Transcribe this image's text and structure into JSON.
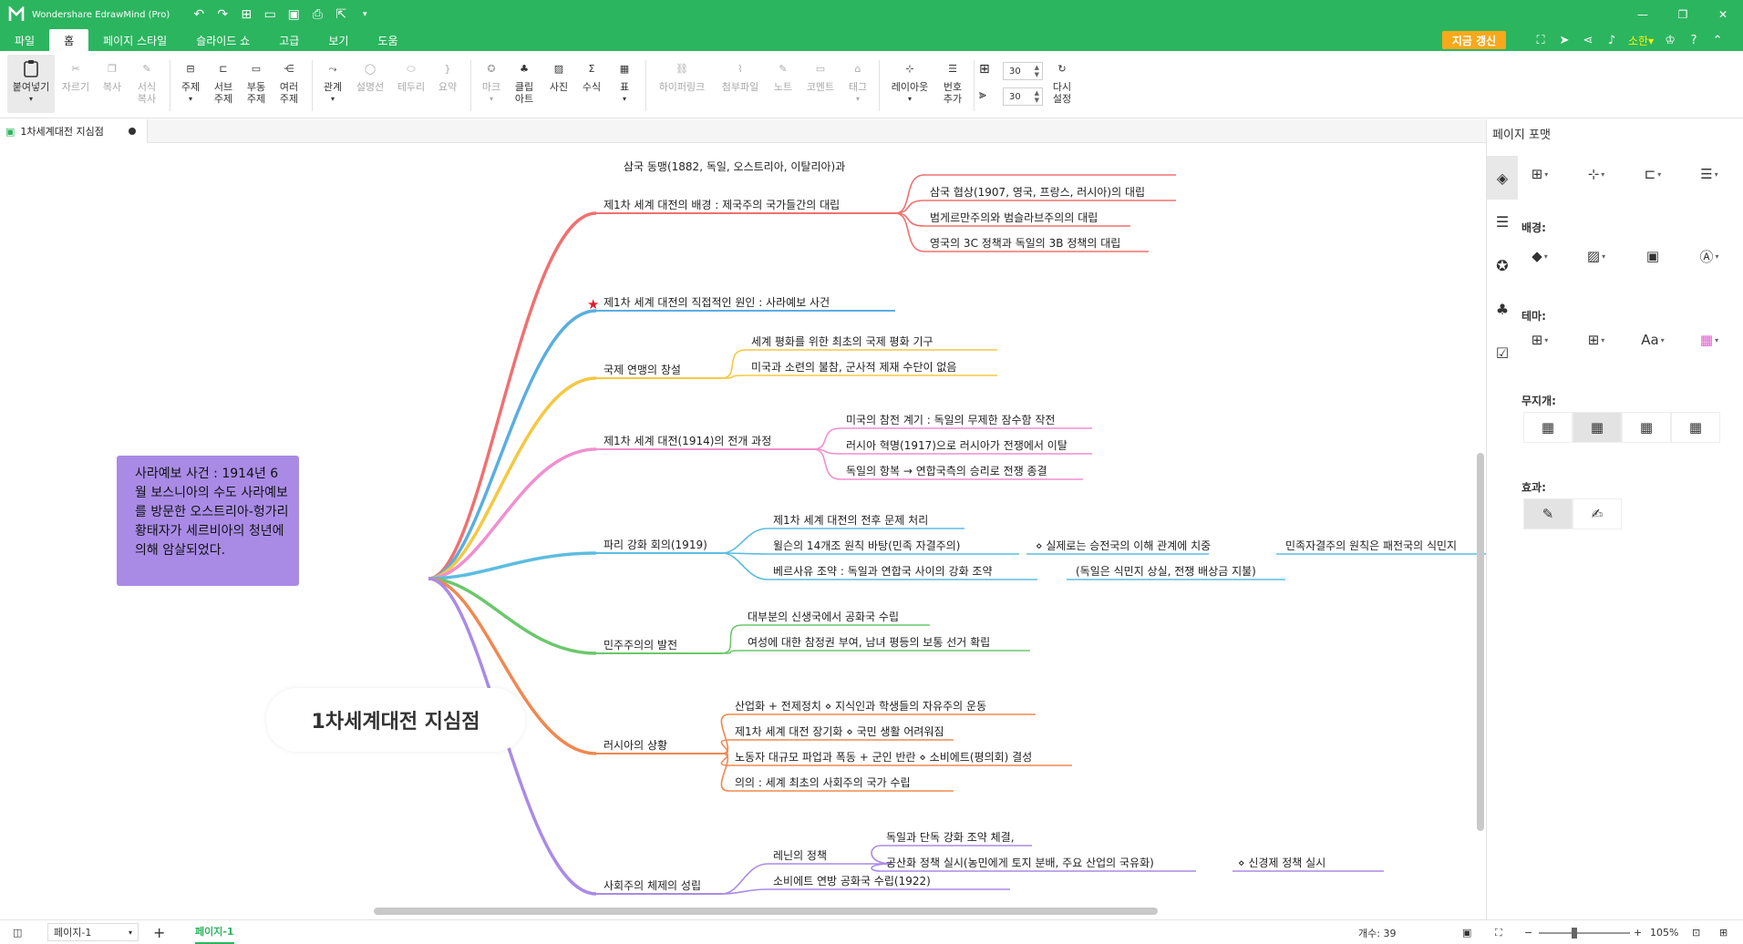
{
  "app": {
    "title": "Wondershare EdrawMind (Pro)"
  },
  "menu": {
    "tabs": [
      "파일",
      "홈",
      "페이지 스타일",
      "슬라이드 쇼",
      "고급",
      "보기",
      "도움"
    ],
    "active": 1
  },
  "header_right": {
    "upgrade": "지금 갱신",
    "user": "소한▾"
  },
  "ribbon": {
    "paste": "붙여넣기",
    "cut": "자르기",
    "copy": "복사",
    "format_copy": "서식\n복사",
    "topic": "주제",
    "subtopic": "서브\n주제",
    "floating": "부동\n주제",
    "multiple": "여러\n주제",
    "relation": "관계",
    "callout": "설명선",
    "boundary": "테두리",
    "summary": "요약",
    "mark": "마크",
    "clipart": "클립\n아트",
    "picture": "사진",
    "formula": "수식",
    "table": "표",
    "hyperlink": "하이퍼링크",
    "attachment": "첨부파일",
    "note": "노트",
    "comment": "코멘트",
    "tag": "태그",
    "layout": "레이아웃",
    "numbering": "번호\n추가",
    "spacing_h": "30",
    "spacing_v": "30",
    "reset": "다시\n설정"
  },
  "document": {
    "tab": "1차세계대전 지심점"
  },
  "mindmap": {
    "central": "1차세계대전 지심점",
    "callout": "사라예보 사건 : 1914년 6월 보스니아의 수도 사라예보를 방문한 오스트리아-헝가리 황태자가 세르비아의 청년에 의해 암살되었다.",
    "branches": [
      {
        "label": "제1차 세계 대전의 배경 : 제국주의 국가들간의 대립",
        "color": "#f07070",
        "children": [
          "삼국 동맹(1882, 독일, 오스트리아, 이탈리아)과",
          "삼국 협상(1907, 영국, 프랑스, 러시아)의 대립",
          "범게르만주의와 범슬라브주의의 대립",
          "영국의 3C 정책과 독일의 3B 정책의 대립"
        ]
      },
      {
        "label": "제1차 세계 대전의 직접적인 원인 : 사라예보 사건",
        "color": "#5aaee0",
        "children": []
      },
      {
        "label": "국제 연맹의 창설",
        "color": "#f5c842",
        "children": [
          "세계 평화를 위한 최초의 국제 평화 기구",
          "미국과 소련의 불참, 군사적 제재 수단이 없음"
        ]
      },
      {
        "label": "제1차 세계 대전(1914)의 전개 과정",
        "color": "#f08fd0",
        "children": [
          "미국의 참전 계기 : 독일의 무제한 잠수함 작전",
          "러시아 혁명(1917)으로 러시아가 전쟁에서 이탈",
          "독일의 항복 → 연합국측의 승리로 전쟁 종결"
        ]
      },
      {
        "label": "파리 강화 회의(1919)",
        "color": "#5bbde0",
        "children": [
          "제1차 세계 대전의 전후 문제 처리",
          "윌슨의 14개조 원칙 바탕(민족 자결주의)",
          "베르사유 조약 : 독일과 연합국 사이의 강화 조약"
        ],
        "extra": [
          "⋄ 실제로는 승전국의 이해 관계에 치중",
          "민족자결주의 원칙은 패전국의 식민지",
          "(독일은 식민지 상실, 전쟁 배상금 지불)"
        ]
      },
      {
        "label": "민주주의의 발전",
        "color": "#6cc76c",
        "children": [
          "대부분의 신생국에서 공화국 수립",
          "여성에 대한 참정권 부여, 남녀 평등의 보통 선거 확립"
        ]
      },
      {
        "label": "러시아의 상황",
        "color": "#f08850",
        "children": [
          "산업화 + 전제정치 ⋄ 지식인과 학생들의 자유주의 운동",
          "제1차 세계 대전 장기화 ⋄ 국민 생활 어려워짐",
          "노동자 대규모 파업과 폭동 + 군인 반란 ⋄ 소비에트(평의회) 결성",
          "의의 : 세계 최초의 사회주의 국가 수립"
        ]
      },
      {
        "label": "사회주의 체제의 성립",
        "color": "#a98be6",
        "children": [
          "레닌의 정책",
          "소비에트 연방 공화국 수립(1922)"
        ],
        "sub": [
          "독일과 단독 강화 조약 체결,",
          "공산화 정책 실시(농민에게 토지 분배, 주요 산업의 국유화)",
          "⋄ 신경제 정책 실시"
        ]
      }
    ]
  },
  "panel": {
    "title": "페이지 포맷",
    "background": "배경:",
    "theme": "테마:",
    "rainbow": "무지개:",
    "effect": "효과:"
  },
  "status": {
    "page_select": "페이지-1",
    "page_tab": "페이지-1",
    "count": "개수: 39",
    "zoom": "105%"
  }
}
